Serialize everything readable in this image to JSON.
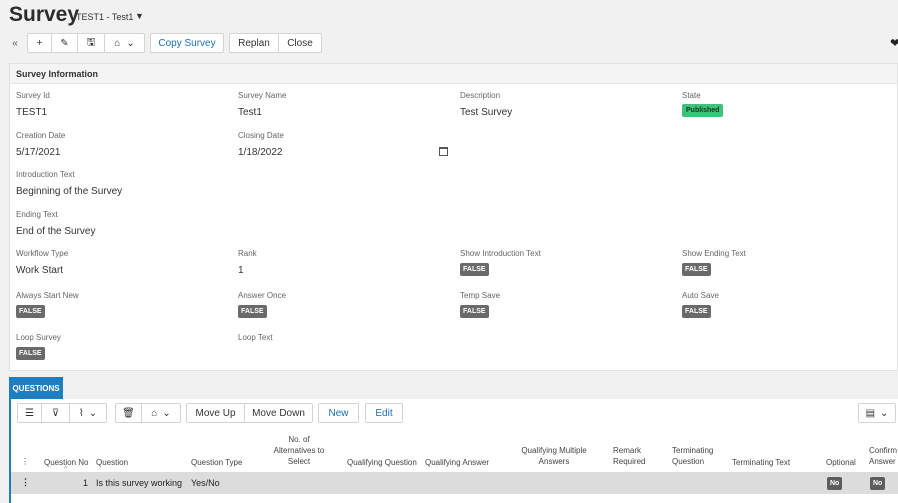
{
  "header": {
    "title": "Survey",
    "record": "TEST1 - Test1",
    "record_caret": "▼"
  },
  "toolbar": {
    "back_icon": "«",
    "add_icon": "+",
    "edit_icon": "✎",
    "save_icon": "🖫",
    "more_icon": "⌂",
    "more_caret": "⌄",
    "copy_label": "Copy Survey",
    "replan_label": "Replan",
    "close_label": "Close"
  },
  "survey_info": {
    "section_title": "Survey Information",
    "survey_id": {
      "label": "Survey Id",
      "value": "TEST1"
    },
    "survey_name": {
      "label": "Survey Name",
      "value": "Test1"
    },
    "description": {
      "label": "Description",
      "value": "Test Survey"
    },
    "state": {
      "label": "State",
      "value": "Published"
    },
    "creation_date": {
      "label": "Creation Date",
      "value": "5/17/2021"
    },
    "closing_date": {
      "label": "Closing Date",
      "value": "1/18/2022"
    },
    "introduction_text": {
      "label": "Introduction Text",
      "value": "Beginning of the Survey"
    },
    "ending_text": {
      "label": "Ending Text",
      "value": "End of the Survey"
    },
    "workflow_type": {
      "label": "Workflow Type",
      "value": "Work Start"
    },
    "rank": {
      "label": "Rank",
      "value": "1"
    },
    "show_intro": {
      "label": "Show Introduction Text",
      "value": "FALSE"
    },
    "show_ending": {
      "label": "Show Ending Text",
      "value": "FALSE"
    },
    "always_start_new": {
      "label": "Always Start New",
      "value": "FALSE"
    },
    "answer_once": {
      "label": "Answer Once",
      "value": "FALSE"
    },
    "temp_save": {
      "label": "Temp Save",
      "value": "FALSE"
    },
    "auto_save": {
      "label": "Auto Save",
      "value": "FALSE"
    },
    "loop_survey": {
      "label": "Loop Survey",
      "value": "FALSE"
    },
    "loop_text": {
      "label": "Loop Text",
      "value": ""
    }
  },
  "questions": {
    "tab_label": "QUESTIONS",
    "toolbar": {
      "list_icon": "☰",
      "filter_icon": "⊽",
      "chart_icon": "⌇",
      "chart_caret": "⌄",
      "delete_icon": "🗑",
      "more_icon": "⌂",
      "more_caret": "⌄",
      "move_up_label": "Move Up",
      "move_down_label": "Move Down",
      "new_label": "New",
      "edit_label": "Edit",
      "columns_icon": "▤",
      "columns_caret": "⌄"
    },
    "columns": [
      "Question No",
      "Question",
      "Question Type",
      "No. of\nAlternatives to\nSelect",
      "Qualifying Question",
      "Qualifying Answer",
      "Qualifying Multiple\nAnswers",
      "Remark\nRequired",
      "Terminating\nQuestion",
      "Terminating Text",
      "Optional",
      "Confirm\nAnswer"
    ],
    "sort_indicator": "^",
    "rows": [
      {
        "menu": "⋮",
        "question_no": "1",
        "question": "Is this survey working",
        "question_type": "Yes/No",
        "optional": "No",
        "confirm_answer": "No"
      }
    ],
    "header_menu": "⋮"
  },
  "colors": {
    "accent": "#1e7fc0",
    "link": "#1b6fb5",
    "published": "#3fc17a",
    "badge": "#6a6a6a"
  }
}
